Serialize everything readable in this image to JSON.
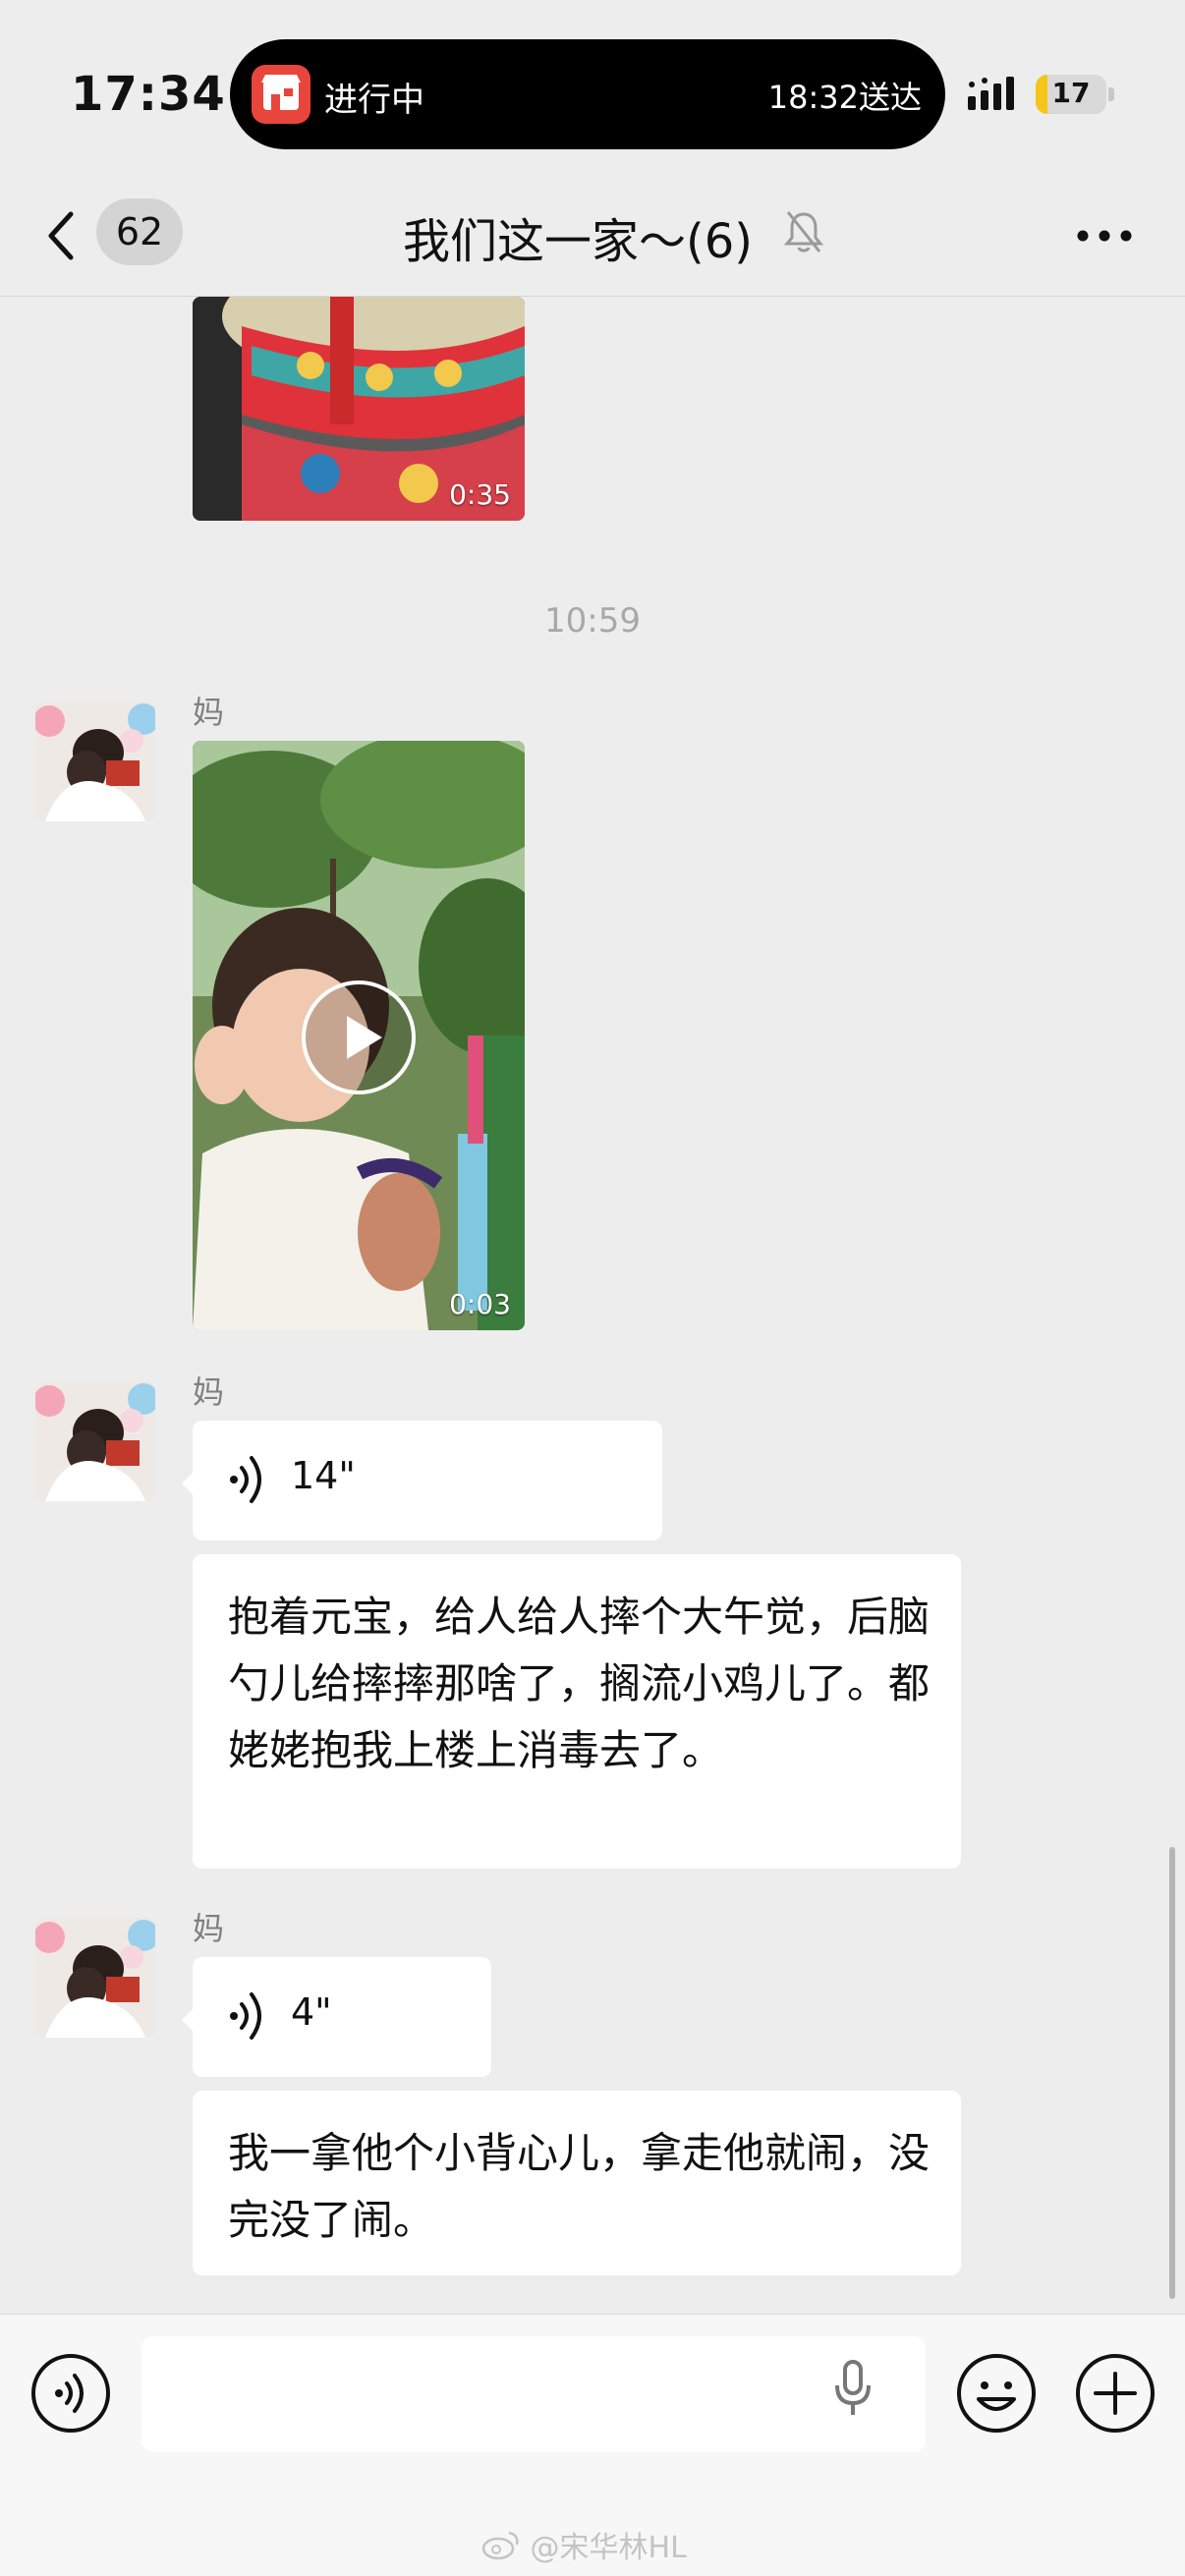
{
  "status_bar": {
    "time": "17:34",
    "island_left": "进行中",
    "island_right": "18:32送达",
    "battery": "17",
    "battery_level": 0.17
  },
  "header": {
    "unread_count": "62",
    "title": "我们这一家～(6)"
  },
  "messages": [
    {
      "type": "video",
      "duration": "0:35"
    },
    {
      "type": "timestamp",
      "text": "10:59"
    },
    {
      "type": "video",
      "sender": "妈",
      "duration": "0:03"
    },
    {
      "type": "voice",
      "sender": "妈",
      "duration": "14\""
    },
    {
      "type": "text",
      "text": "抱着元宝，给人给人摔个大午觉，后脑勺儿给摔摔那啥了，搁流小鸡儿了。都姥姥抱我上楼上消毒去了。"
    },
    {
      "type": "voice",
      "sender": "妈",
      "duration": "4\""
    },
    {
      "type": "text",
      "text": "我一拿他个小背心儿，拿走他就闹，没完没了闹。"
    }
  ],
  "input": {
    "value": ""
  },
  "watermark": "@宋华林HL",
  "icons": [
    "back-icon",
    "mute-icon",
    "more-icon",
    "play-icon",
    "voice-wave-icon",
    "voice-toggle-icon",
    "mic-icon",
    "emoji-icon",
    "plus-icon",
    "weibo-icon"
  ]
}
